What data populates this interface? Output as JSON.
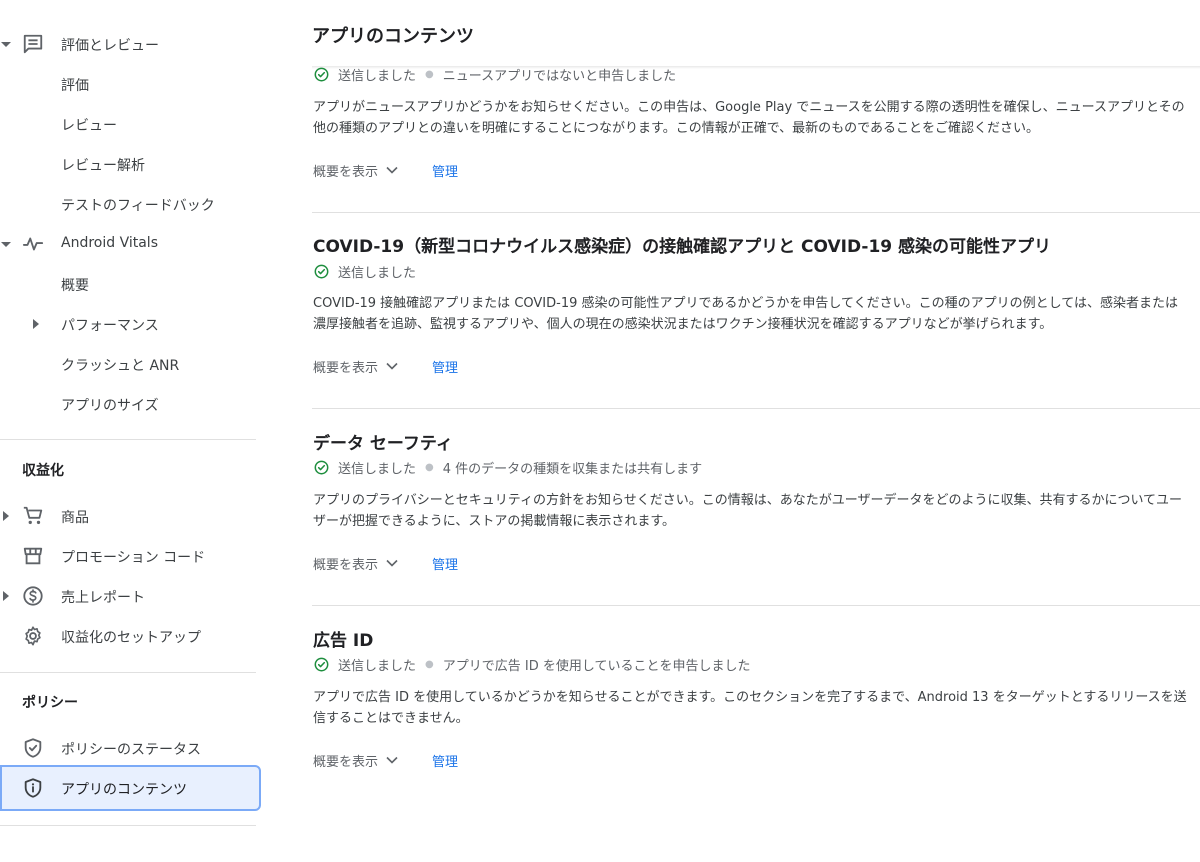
{
  "sidebar": {
    "ratings_group": "評価とレビュー",
    "ratings_items": [
      "評価",
      "レビュー",
      "レビュー解析",
      "テストのフィードバック"
    ],
    "vitals_group": "Android Vitals",
    "vitals_items": [
      "概要",
      "パフォーマンス",
      "クラッシュと ANR",
      "アプリのサイズ"
    ],
    "monetize_title": "収益化",
    "monetize_items": [
      "商品",
      "プロモーション コード",
      "売上レポート",
      "収益化のセットアップ"
    ],
    "policy_title": "ポリシー",
    "policy_items": [
      "ポリシーのステータス",
      "アプリのコンテンツ"
    ]
  },
  "main": {
    "title": "アプリのコンテンツ",
    "summary_label": "概要を表示",
    "manage_label": "管理",
    "cards": [
      {
        "title": "",
        "status": "送信しました",
        "detail": "ニュースアプリではないと申告しました",
        "description": "アプリがニュースアプリかどうかをお知らせください。この申告は、Google Play でニュースを公開する際の透明性を確保し、ニュースアプリとその他の種類のアプリとの違いを明確にすることにつながります。この情報が正確で、最新のものであることをご確認ください。"
      },
      {
        "title": "COVID-19（新型コロナウイルス感染症）の接触確認アプリと COVID-19 感染の可能性アプリ",
        "status": "送信しました",
        "detail": "",
        "description": "COVID-19 接触確認アプリまたは COVID-19 感染の可能性アプリであるかどうかを申告してください。この種のアプリの例としては、感染者または濃厚接触者を追跡、監視するアプリや、個人の現在の感染状況またはワクチン接種状況を確認するアプリなどが挙げられます。"
      },
      {
        "title": "データ セーフティ",
        "status": "送信しました",
        "detail": "4 件のデータの種類を収集または共有します",
        "description": "アプリのプライバシーとセキュリティの方針をお知らせください。この情報は、あなたがユーザーデータをどのように収集、共有するかについてユーザーが把握できるように、ストアの掲載情報に表示されます。"
      },
      {
        "title": "広告 ID",
        "status": "送信しました",
        "detail": "アプリで広告 ID を使用していることを申告しました",
        "description": "アプリで広告 ID を使用しているかどうかを知らせることができます。このセクションを完了するまで、Android 13 をターゲットとするリリースを送信することはできません。"
      }
    ]
  },
  "colors": {
    "accent": "#1a73e8",
    "success": "#1e8e3e",
    "active_bg": "#e8f0fe"
  }
}
